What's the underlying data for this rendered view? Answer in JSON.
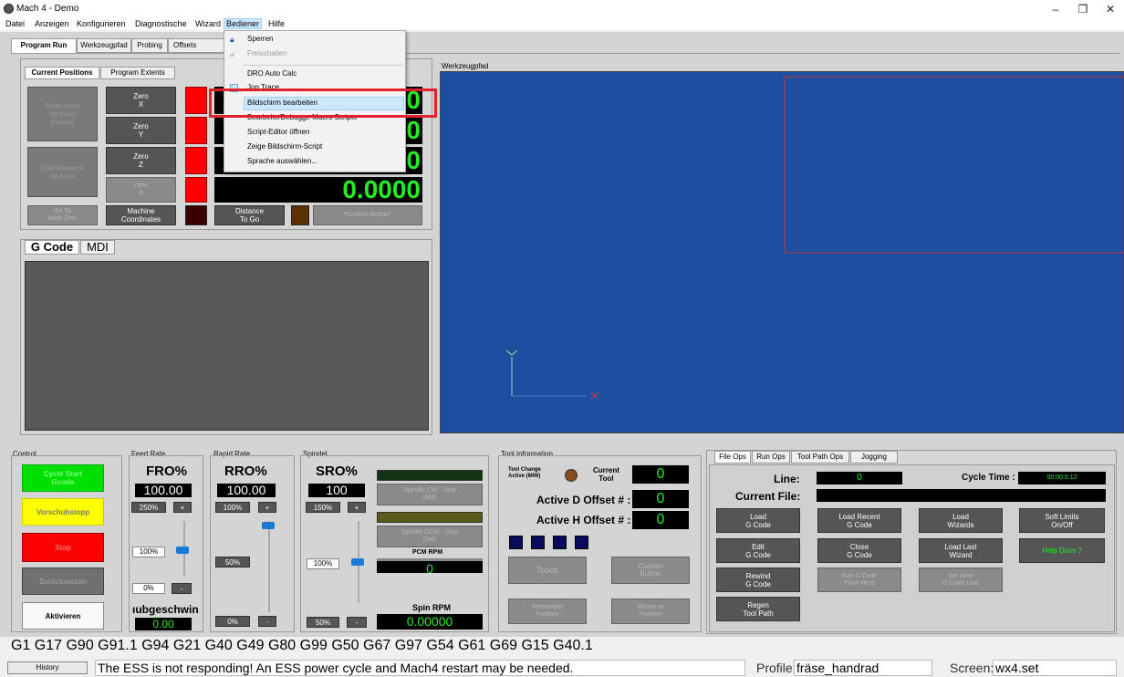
{
  "window": {
    "title": "Mach 4 - Demo",
    "minimize": "–",
    "maximize": "❐",
    "close": "✕"
  },
  "menubar": [
    "Datei",
    "Anzeigen",
    "Konfigurieren",
    "Diagnostische",
    "Wizard",
    "Bediener",
    "Hilfe"
  ],
  "tabs": [
    "Program Run",
    "Werkzeugpfad",
    "Probing",
    "Offsets"
  ],
  "positions": {
    "tabs": [
      "Current Positions",
      "Program Extents"
    ],
    "ref_all": [
      "Reference",
      "All Axes",
      "(Home)"
    ],
    "deref_all": [
      "DeReference",
      "All Axes"
    ],
    "zero_x": [
      "Zero",
      "X"
    ],
    "zero_y": [
      "Zero",
      "Y"
    ],
    "zero_z": [
      "Zero",
      "Z"
    ],
    "zero_a": [
      "Zero",
      "A"
    ],
    "go_to_work_zero": [
      "Go To",
      "Work Zero"
    ],
    "machine_coords": [
      "Machine",
      "Coordinates"
    ],
    "distance_to_go": [
      "Distance",
      "To Go"
    ],
    "custom_button": "*Custom Button*",
    "dro_x": "0",
    "dro_y": "0",
    "dro_z": "0",
    "dro_a": "0.0000"
  },
  "gcode_tabs": [
    "G Code",
    "MDI"
  ],
  "toolpath_label": "Werkzeugpfad",
  "dropdown": {
    "lock": "Sperren",
    "unlock": "Freischalten",
    "dro_auto": "DRO Auto Calc",
    "jog_trace": "Jog Trace",
    "edit_screen": "Bildschirm bearbeiten",
    "edit_debug": "Bearbeite/Debugge Macro Scripte",
    "script_editor": "Script-Editor öffnen",
    "show_script": "Zeige Bildschirm-Script",
    "language": "Sprache auswählen..."
  },
  "control": {
    "label": "Control",
    "cycle_start": [
      "Cycle Start",
      "Gcode"
    ],
    "feedhold": "Vorschubstopp",
    "stop": "Stop",
    "reset": "Zurücksetzen",
    "enable": "Aktivieren"
  },
  "feedrate": {
    "label": "Feed Rate",
    "title": "FRO%",
    "value": "100.00",
    "max": "250%",
    "plus": "+",
    "cur": "100%",
    "min": "0%",
    "minus": "-",
    "caption": "ıubgeschwin",
    "feed": "0.00"
  },
  "rapid": {
    "label": "Rapid Rate",
    "title": "RRO%",
    "value": "100.00",
    "max": "100%",
    "plus": "+",
    "mid": "50%",
    "min": "0%",
    "minus": "-"
  },
  "spindle": {
    "label": "Spindel",
    "title": "SRO%",
    "value": "100",
    "max": "150%",
    "plus": "+",
    "cur": "100%",
    "min": "50%",
    "minus": "-",
    "cw": [
      "Spindle CW - Stop",
      "(M3)",
      "(M5)"
    ],
    "ccw": [
      "Spindle CCW - Stop",
      "(M4)",
      "(M5)"
    ],
    "pcm_label": "PCM RPM",
    "pcm_value": "0",
    "spin_label": "Spin RPM",
    "spin_value": "0.00000"
  },
  "tool": {
    "label": "Tool Information",
    "change": [
      "Tool Change",
      "Active (M06)"
    ],
    "current": [
      "Current",
      "Tool"
    ],
    "current_value": "0",
    "d_offset": "Active D Offset # :",
    "d_value": "0",
    "h_offset": "Active H Offset # :",
    "h_value": "0",
    "touch": "Touch",
    "custom": [
      "Custom",
      "Button"
    ],
    "remember": [
      "Remember",
      "Position"
    ],
    "return": [
      "Return to",
      "Position"
    ]
  },
  "fileops": {
    "tabs": [
      "File Ops",
      "Run Ops",
      "Tool Path Ops",
      "Jogging"
    ],
    "line_label": "Line:",
    "line_value": "0",
    "cycle_label": "Cycle Time :",
    "cycle_value": "00:00:0.12",
    "current_file": "Current File:",
    "load_gcode": [
      "Load",
      "G Code"
    ],
    "load_recent": [
      "Load Recent",
      "G Code"
    ],
    "load_wizards": [
      "Load",
      "Wizards"
    ],
    "soft_limits": [
      "Soft Limits",
      "On/Off"
    ],
    "edit_gcode": [
      "Edit",
      "G Code"
    ],
    "close_gcode": [
      "Close",
      "G Code"
    ],
    "load_last_wizard": [
      "Load Last",
      "Wizard"
    ],
    "help_docs": "Help Docs ?",
    "rewind": [
      "Rewind",
      "G Code"
    ],
    "run_from_here": [
      "Run G Code",
      "From Here"
    ],
    "set_next": [
      "Set Next",
      "G Code Line"
    ],
    "regen": [
      "Regen",
      "Tool Path"
    ]
  },
  "modal_line": "G1 G17 G90 G91.1 G94 G21 G40 G49 G80 G99 G50 G67 G97 G54 G61 G69 G15 G40.1",
  "status": {
    "history": "History",
    "message": "The ESS is not responding! An ESS power cycle and Mach4 restart may be needed.",
    "profile_label": "Profile:",
    "profile": "fräse_handrad",
    "screen_label": "Screen:",
    "screen": "wx4.set"
  },
  "colors": {
    "toolpath_bg": "#1c4fa0",
    "dro_green": "#22ee22",
    "highlight": "#e0202a"
  }
}
